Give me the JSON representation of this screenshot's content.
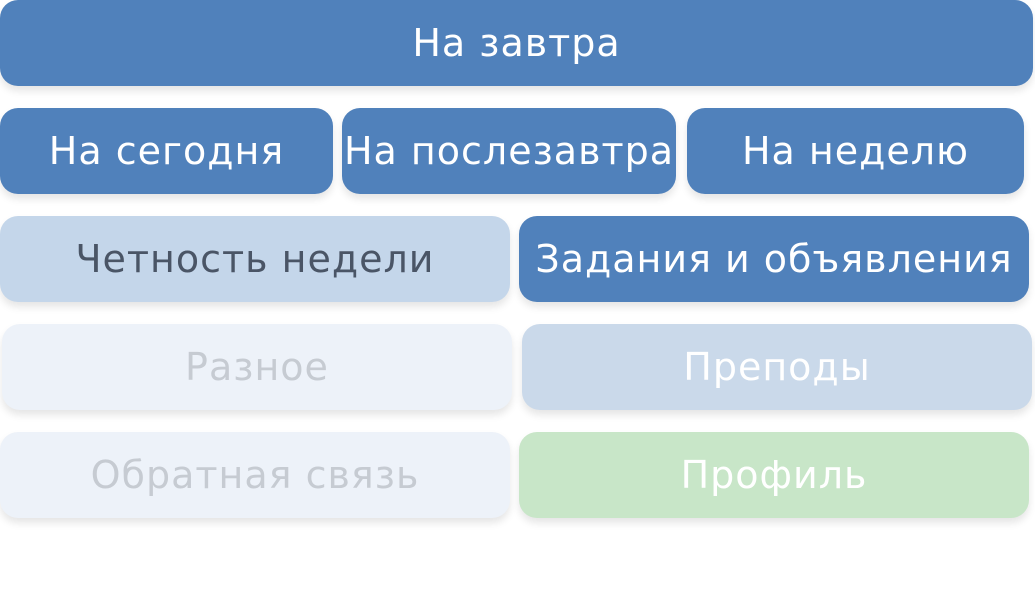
{
  "keyboard": {
    "row1": {
      "tomorrow": "На завтра"
    },
    "row2": {
      "today": "На сегодня",
      "day_after": "На послезавтра",
      "week": "На неделю"
    },
    "row3": {
      "week_parity": "Четность недели",
      "tasks": "Задания и объявления"
    },
    "row4": {
      "misc": "Разное",
      "teachers": "Преподы"
    },
    "row5": {
      "feedback": "Обратная связь",
      "profile": "Профиль"
    }
  },
  "colors": {
    "primary": "#5081bb",
    "secondary": "#c4d6ea",
    "faint": "#edf2f9",
    "positive": "#c8e6c8"
  }
}
